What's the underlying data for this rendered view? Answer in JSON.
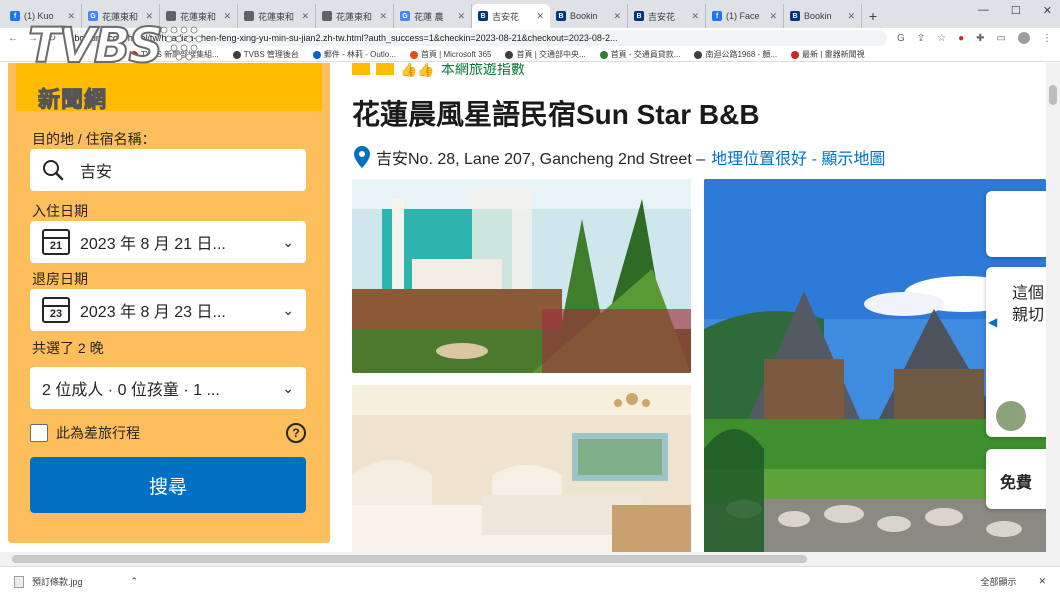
{
  "browser": {
    "tabs": [
      {
        "title": "(1) Kuo",
        "favicon_color": "#1877f2",
        "favicon_glyph": "f",
        "active": false
      },
      {
        "title": "花蓮東和",
        "favicon_color": "#4285f4",
        "favicon_glyph": "G",
        "active": false
      },
      {
        "title": "花蓮東和",
        "favicon_color": "#5f6368",
        "favicon_glyph": "",
        "active": false
      },
      {
        "title": "花蓮東和",
        "favicon_color": "#5f6368",
        "favicon_glyph": "",
        "active": false
      },
      {
        "title": "花蓮東和",
        "favicon_color": "#5f6368",
        "favicon_glyph": "",
        "active": false
      },
      {
        "title": "花蓮 農",
        "favicon_color": "#4285f4",
        "favicon_glyph": "G",
        "active": false
      },
      {
        "title": "吉安花",
        "favicon_color": "#003580",
        "favicon_glyph": "B",
        "active": true
      },
      {
        "title": "Bookin",
        "favicon_color": "#003580",
        "favicon_glyph": "B",
        "active": false
      },
      {
        "title": "吉安花",
        "favicon_color": "#003580",
        "favicon_glyph": "B",
        "active": false
      },
      {
        "title": "(1) Face",
        "favicon_color": "#1877f2",
        "favicon_glyph": "f",
        "active": false
      },
      {
        "title": "Bookin",
        "favicon_color": "#003580",
        "favicon_glyph": "B",
        "active": false
      }
    ],
    "new_tab_label": "+",
    "url": "booking.com/hotel/tw/hua-lian-chen-feng-xing-yu-min-su-jian2.zh-tw.html?auth_success=1&checkin=2023-08-21&checkout=2023-08-2...",
    "bookmarks": [
      {
        "label": "TVBS 新聞部搜集組...",
        "color": "#c62828"
      },
      {
        "label": "TVBS 管理後台",
        "color": "#3c4043"
      },
      {
        "label": "郵件 - 林莉 - Outlo...",
        "color": "#0a64c8"
      },
      {
        "label": "首頁 | Microsoft 365",
        "color": "#e64a19"
      },
      {
        "label": "首頁 | 交通部中央...",
        "color": "#3c4043"
      },
      {
        "label": "首頁 - 交通員貸款...",
        "color": "#2e7d32"
      },
      {
        "label": "南迴公路1968 - 顏...",
        "color": "#3c4043"
      },
      {
        "label": "最新 | 靈器新聞視",
        "color": "#c62828"
      }
    ]
  },
  "logo": {
    "brand": "TVBS",
    "subtitle": "新聞網"
  },
  "search_panel": {
    "destination_label": "目的地 / 住宿名稱：",
    "destination_value": "吉安",
    "checkin_label": "入住日期",
    "checkin_value": "2023 年 8 月 21 日...",
    "checkin_day": "21",
    "checkout_label": "退房日期",
    "checkout_value": "2023 年 8 月 23 日...",
    "checkout_day": "23",
    "nights_label": "共選了 2 晚",
    "guests_value": "2 位成人 · 0 位孩童 · 1 ...",
    "business_trip_label": "此為差旅行程",
    "search_button": "搜尋"
  },
  "hotel": {
    "rating_badge": "本網旅遊指數",
    "name": "花蓮晨風星語民宿Sun Star B&B",
    "address": "吉安No. 28, Lane 207, Gancheng 2nd Street –",
    "location_link": "地理位置很好 - 顯示地圖"
  },
  "side_popup": {
    "text_1": "這個",
    "text_2": "親切",
    "text_3": "免費"
  },
  "downloads": {
    "file_name": "預訂條款.jpg",
    "show_all": "全部顯示"
  },
  "colors": {
    "accent_yellow": "#febb02",
    "link_blue": "#0071c2",
    "button_blue": "#0071c2",
    "panel_orange": "#ffbe5c"
  }
}
